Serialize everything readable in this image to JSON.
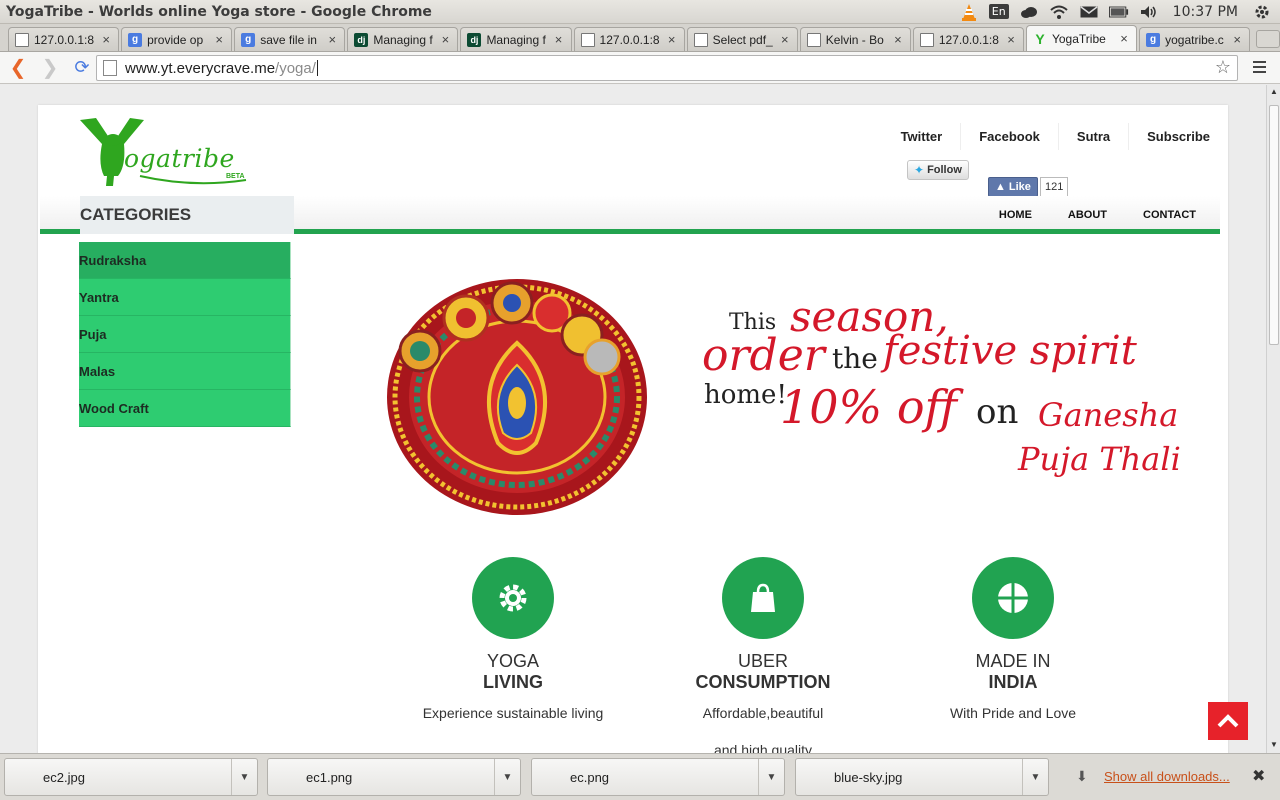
{
  "window": {
    "title": "YogaTribe - Worlds online Yoga store - Google Chrome",
    "tray": {
      "language": "En",
      "time": "10:37 PM"
    }
  },
  "tabs": [
    {
      "label": "127.0.0.1:8",
      "favicon": "doc-icon",
      "close": "×"
    },
    {
      "label": "provide op",
      "favicon": "google-icon",
      "close": "×"
    },
    {
      "label": "save file in",
      "favicon": "google-icon",
      "close": "×"
    },
    {
      "label": "Managing f",
      "favicon": "django-icon",
      "close": "×"
    },
    {
      "label": "Managing f",
      "favicon": "django-icon",
      "close": "×"
    },
    {
      "label": "127.0.0.1:8",
      "favicon": "doc-icon",
      "close": "×"
    },
    {
      "label": "Select pdf_",
      "favicon": "doc-icon",
      "close": "×"
    },
    {
      "label": "Kelvin - Bo",
      "favicon": "doc-icon",
      "close": "×"
    },
    {
      "label": "127.0.0.1:8",
      "favicon": "doc-icon",
      "close": "×"
    },
    {
      "label": "YogaTribe",
      "favicon": "yogatribe-icon",
      "close": "×",
      "active": true
    },
    {
      "label": "yogatribe.c",
      "favicon": "google-icon",
      "close": "×"
    }
  ],
  "toolbar": {
    "url_host": "www.yt.everycrave.me",
    "url_path": "/yoga/"
  },
  "site": {
    "logo_text": "ogatribe",
    "logo_beta": "BETA",
    "social_links": [
      "Twitter",
      "Facebook",
      "Sutra",
      "Subscribe"
    ],
    "twitter_follow": "Follow",
    "fb_like": "Like",
    "fb_count": "121",
    "categories_heading": "CATEGORIES",
    "main_nav": [
      "HOME",
      "ABOUT",
      "CONTACT"
    ],
    "categories": [
      "Rudraksha",
      "Yantra",
      "Puja",
      "Malas",
      "Wood Craft"
    ]
  },
  "promo": {
    "this": "This",
    "season": "season,",
    "order": "order",
    "the": "the",
    "festive_spirit": "festive spirit",
    "home": "home!",
    "discount": "10% off",
    "on": "on",
    "product_line1": "Ganesha",
    "product_line2": "Puja Thali"
  },
  "features": [
    {
      "line1": "YOGA",
      "line2": "LIVING",
      "desc": "Experience sustainable living",
      "desc2": "",
      "icon": "gear-icon"
    },
    {
      "line1": "UBER",
      "line2": "CONSUMPTION",
      "desc": "Affordable,beautiful",
      "desc2": "and high quality",
      "icon": "shopping-bag-icon"
    },
    {
      "line1": "MADE IN",
      "line2": "INDIA",
      "desc": "With Pride and Love",
      "desc2": "",
      "icon": "grid-circle-icon"
    }
  ],
  "downloads": {
    "items": [
      "ec2.jpg",
      "ec1.png",
      "ec.png",
      "blue-sky.jpg"
    ],
    "show_all": "Show all downloads...",
    "close": "✖"
  },
  "colors": {
    "brand_green": "#21a351",
    "category_green": "#2ecc71",
    "promo_red": "#d4182a",
    "scroll_top_red": "#e7222a"
  }
}
